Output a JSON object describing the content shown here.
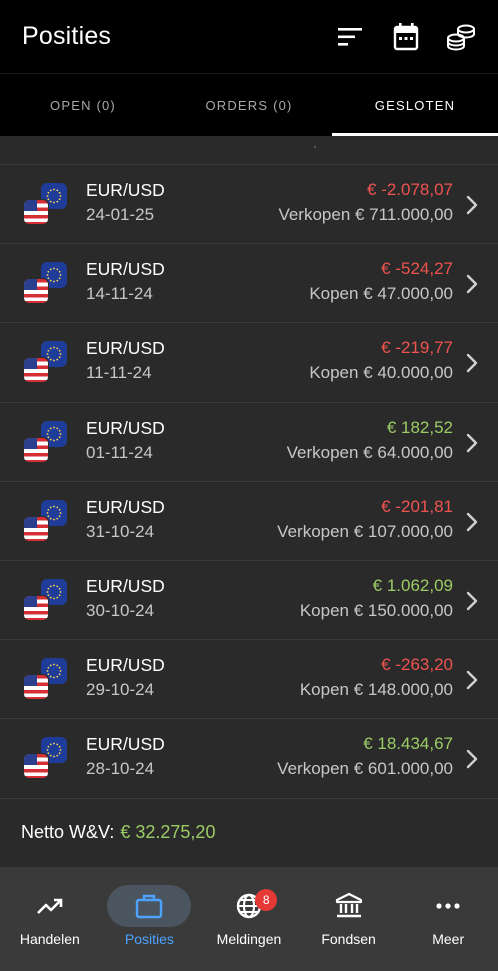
{
  "header": {
    "title": "Posities",
    "icons": [
      "sort-icon",
      "calendar-icon",
      "coins-icon"
    ]
  },
  "tabs": [
    {
      "label": "OPEN (0)",
      "active": false
    },
    {
      "label": "ORDERS (0)",
      "active": false
    },
    {
      "label": "GESLOTEN",
      "active": true
    }
  ],
  "positions": [
    {
      "pair": "EUR/USD",
      "date": "24-01-25",
      "pl": "€ -2.078,07",
      "pl_sign": "neg",
      "side": "Verkopen € 711.000,00"
    },
    {
      "pair": "EUR/USD",
      "date": "14-11-24",
      "pl": "€ -524,27",
      "pl_sign": "neg",
      "side": "Kopen € 47.000,00"
    },
    {
      "pair": "EUR/USD",
      "date": "11-11-24",
      "pl": "€ -219,77",
      "pl_sign": "neg",
      "side": "Kopen € 40.000,00"
    },
    {
      "pair": "EUR/USD",
      "date": "01-11-24",
      "pl": "€ 182,52",
      "pl_sign": "pos",
      "side": "Verkopen € 64.000,00"
    },
    {
      "pair": "EUR/USD",
      "date": "31-10-24",
      "pl": "€ -201,81",
      "pl_sign": "neg",
      "side": "Verkopen € 107.000,00"
    },
    {
      "pair": "EUR/USD",
      "date": "30-10-24",
      "pl": "€ 1.062,09",
      "pl_sign": "pos",
      "side": "Kopen € 150.000,00"
    },
    {
      "pair": "EUR/USD",
      "date": "29-10-24",
      "pl": "€ -263,20",
      "pl_sign": "neg",
      "side": "Kopen € 148.000,00"
    },
    {
      "pair": "EUR/USD",
      "date": "28-10-24",
      "pl": "€ 18.434,67",
      "pl_sign": "pos",
      "side": "Verkopen € 601.000,00"
    }
  ],
  "summary": {
    "label": "Netto W&V:",
    "value": "€ 32.275,20"
  },
  "bottom_nav": [
    {
      "label": "Handelen",
      "icon": "trending-up-icon",
      "active": false
    },
    {
      "label": "Posities",
      "icon": "briefcase-icon",
      "active": true
    },
    {
      "label": "Meldingen",
      "icon": "globe-icon",
      "active": false,
      "badge": "8"
    },
    {
      "label": "Fondsen",
      "icon": "bank-icon",
      "active": false
    },
    {
      "label": "Meer",
      "icon": "more-icon",
      "active": false
    }
  ],
  "colors": {
    "negative": "#ef5350",
    "positive": "#9ccc65",
    "accent": "#4da3ff",
    "background": "#2a2a2a"
  }
}
